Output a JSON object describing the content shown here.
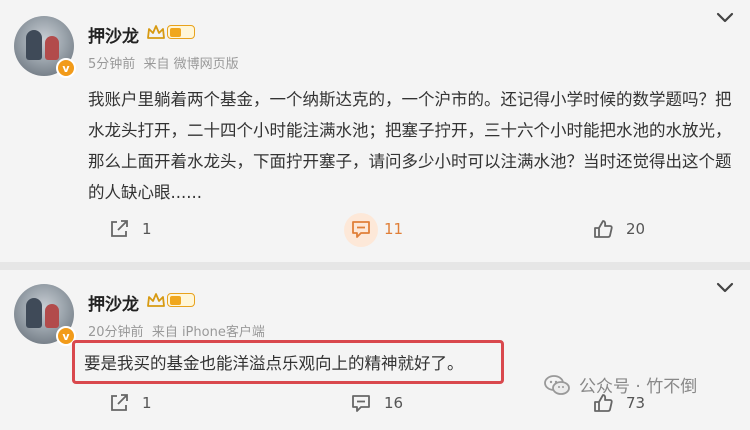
{
  "posts": [
    {
      "username": "押沙龙",
      "time": "5分钟前",
      "source": "来自 微博网页版",
      "verified_mark": "v",
      "text": "我账户里躺着两个基金，一个纳斯达克的，一个沪市的。还记得小学时候的数学题吗？把水龙头打开，二十四个小时能注满水池；把塞子拧开，三十六个小时能把水池的水放光，那么上面开着水龙头，下面拧开塞子，请问多少小时可以注满水池？当时还觉得出这个题的人缺心眼......",
      "repost_count": "1",
      "comment_count": "11",
      "like_count": "20"
    },
    {
      "username": "押沙龙",
      "time": "20分钟前",
      "source": "来自 iPhone客户端",
      "verified_mark": "v",
      "text": "要是我买的基金也能洋溢点乐观向上的精神就好了。",
      "repost_count": "1",
      "comment_count": "16",
      "like_count": "73"
    }
  ],
  "watermark": {
    "text": "公众号 · 竹不倒",
    "icon": "wechat-icon"
  },
  "colors": {
    "highlight_border": "#d9484d",
    "rank_gold": "#f0a71e",
    "comment_active_bg": "#fde8d8"
  }
}
